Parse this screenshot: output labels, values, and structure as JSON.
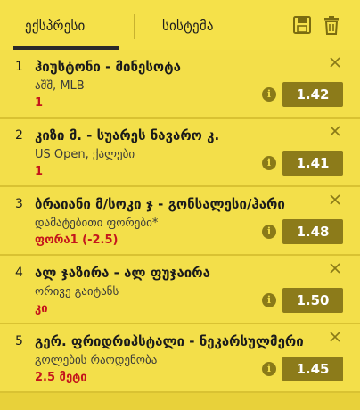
{
  "tabs": [
    {
      "label": "ექსპრესი",
      "active": true
    },
    {
      "label": "სისტემა",
      "active": false
    }
  ],
  "toolbar": {
    "save_icon": "floppy-disk",
    "delete_icon": "trash-can"
  },
  "bets": [
    {
      "num": "1",
      "title": "ჰიუსტონი - მინესოტა",
      "sub": "აშშ, MLB",
      "pick": "1",
      "odds": "1.42"
    },
    {
      "num": "2",
      "title": "კიზი მ. - სუარეს ნავარო კ.",
      "sub": "US Open, ქალები",
      "pick": "1",
      "odds": "1.41"
    },
    {
      "num": "3",
      "title": "ბრაიანი მ/სოკი ჯ - გონსალესი/ჰარი",
      "sub": "დამატებითი ფორები*",
      "pick": "ფორა1 (-2.5)",
      "odds": "1.48"
    },
    {
      "num": "4",
      "title": "ალ ჯაზირა - ალ ფუჯაირა",
      "sub": "ორივე გაიტანს",
      "pick": "კი",
      "odds": "1.50"
    },
    {
      "num": "5",
      "title": "გერ. ფრიდრიჰსტალი - ნეკარსულმერი",
      "sub": "გოლების რაოდენობა",
      "pick": "2.5 მეტი",
      "odds": "1.45"
    }
  ],
  "colors": {
    "background": "#f3df4a",
    "odds_button": "#8c7b1a",
    "pick_text": "#c4161c"
  }
}
